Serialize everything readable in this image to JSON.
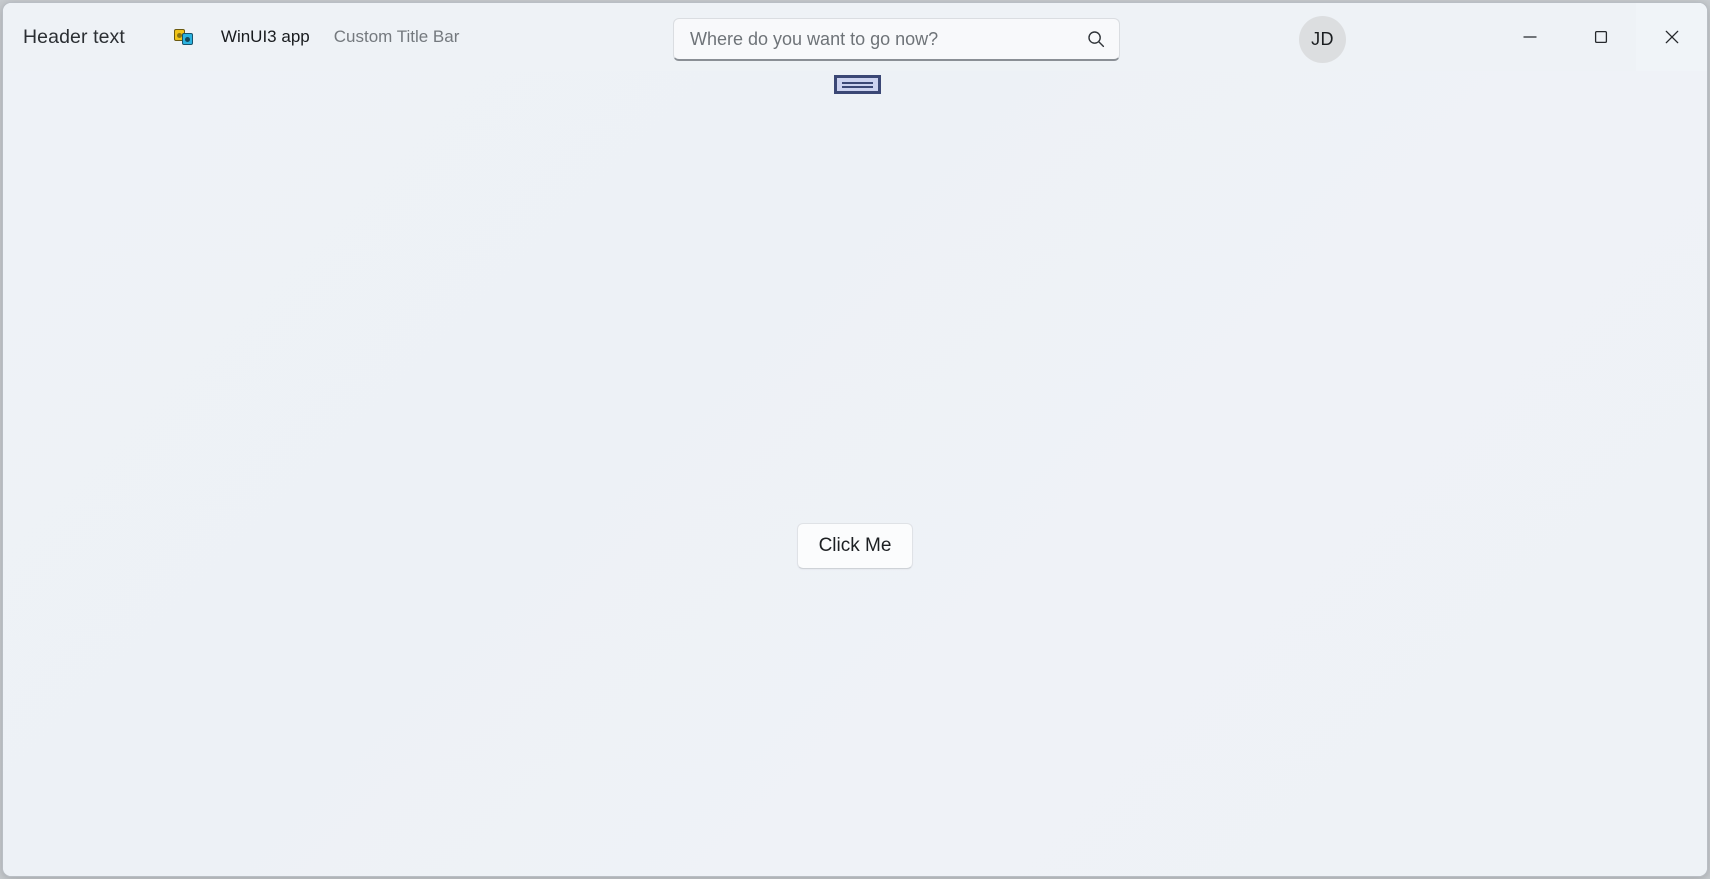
{
  "window": {
    "title_bar": {
      "header_text": "Header text",
      "app_icon_name": "app-gears-icon",
      "app_name": "WinUI3 app",
      "subtitle": "Custom Title Bar"
    },
    "search": {
      "placeholder": "Where do you want to go now?",
      "value": "",
      "icon_name": "search-icon"
    },
    "handle_widget": {
      "name": "drag-handle-widget",
      "border_color": "#3b4775",
      "fill_color": "#ccd2ef"
    },
    "avatar": {
      "initials": "JD",
      "background_color": "#dcdee0"
    },
    "caption_buttons": [
      {
        "name": "minimize-button",
        "label": "Minimize"
      },
      {
        "name": "maximize-button",
        "label": "Maximize"
      },
      {
        "name": "close-button",
        "label": "Close"
      }
    ]
  },
  "content": {
    "click_me_label": "Click Me"
  },
  "colors": {
    "window_background": "#eef2f6",
    "client_background": "#edf1f6",
    "window_border": "#b9bec4",
    "text_primary": "#1b1e21",
    "text_secondary": "#74797e",
    "desktop_backdrop": "#c7cbcf"
  }
}
